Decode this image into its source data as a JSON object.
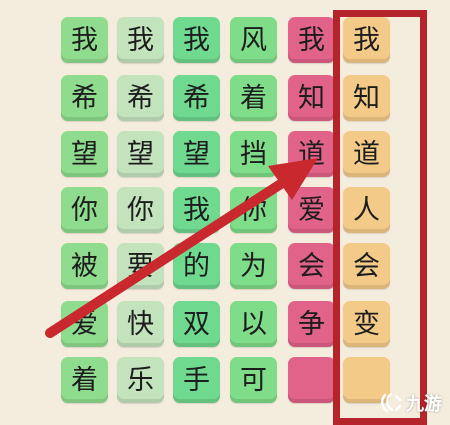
{
  "grid": {
    "columns": [
      [
        "我",
        "希",
        "望",
        "你",
        "被",
        "爱",
        "着"
      ],
      [
        "我",
        "希",
        "望",
        "你",
        "要",
        "快",
        "乐"
      ],
      [
        "我",
        "希",
        "望",
        "我",
        "的",
        "双",
        "手"
      ],
      [
        "风",
        "着",
        "挡",
        "你",
        "为",
        "以",
        "可"
      ],
      [
        "我",
        "知",
        "道",
        "爱",
        "会",
        "争",
        ""
      ],
      [
        "我",
        "知",
        "道",
        "人",
        "会",
        "变",
        ""
      ]
    ]
  },
  "highlight": {
    "selected_column": 5,
    "frame_color": "#b5242a",
    "arrow_color": "#c8282e"
  },
  "colors": {
    "col0": "#8fdc8f",
    "col1": "#c3e3bd",
    "col2": "#6fd98f",
    "col3": "#7fdc88",
    "col4": "#e2638a",
    "col5": "#f4ca88"
  },
  "watermark": {
    "text": "九游",
    "icon": "jiuyou-logo-icon"
  }
}
